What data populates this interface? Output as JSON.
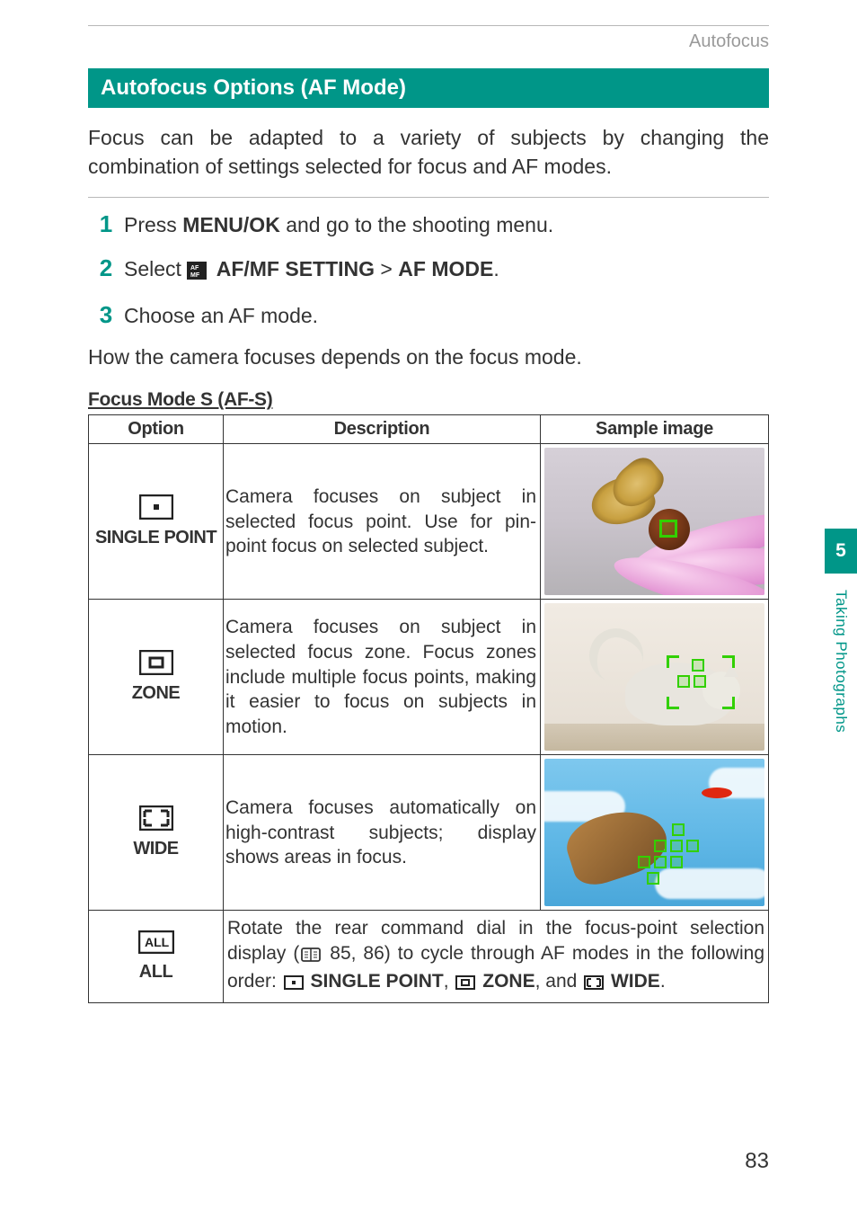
{
  "header": {
    "breadcrumb": "Autofocus"
  },
  "section": {
    "title": "Autofocus Options (AF Mode)"
  },
  "intro": "Focus can be adapted to a variety of subjects by changing the combination of settings selected for focus and AF modes.",
  "steps": [
    {
      "num": "1",
      "p1": "Press ",
      "bold1": "MENU/OK",
      "p2": " and go to the shooting menu."
    },
    {
      "num": "2",
      "p1": "Select ",
      "bold1": "AF/MF SETTING",
      "mid": " > ",
      "bold2": "AF MODE",
      "p2": "."
    },
    {
      "num": "3",
      "p1": "Choose an AF mode."
    }
  ],
  "bodytext": "How the camera focuses depends on the focus mode.",
  "subhead": "Focus Mode S (AF-S)",
  "table": {
    "headers": {
      "option": "Option",
      "description": "Description",
      "sample": "Sample image"
    },
    "rows": [
      {
        "label": "SINGLE POINT",
        "desc": "Camera focuses on subject in selected focus point. Use for pin-point focus on selected subject."
      },
      {
        "label": "ZONE",
        "desc": "Camera focuses on subject in selected focus zone. Focus zones include multiple focus points, making it easier to focus on subjects in motion."
      },
      {
        "label": "WIDE",
        "desc": "Camera focuses automatically on high-contrast subjects; display shows areas in focus."
      }
    ],
    "all": {
      "label": "ALL",
      "d1": "Rotate the rear command dial in the focus-point selection display (",
      "pageref_icon": "📖",
      "pageref": " 85, 86) to cycle through AF modes in the following order: ",
      "b1": "SINGLE POINT",
      "s1": ", ",
      "b2": "ZONE",
      "s2": ", and ",
      "b3": "WIDE",
      "s3": "."
    }
  },
  "sidebar": {
    "chapter_num": "5",
    "chapter_label": "Taking Photographs"
  },
  "page_number": "83"
}
